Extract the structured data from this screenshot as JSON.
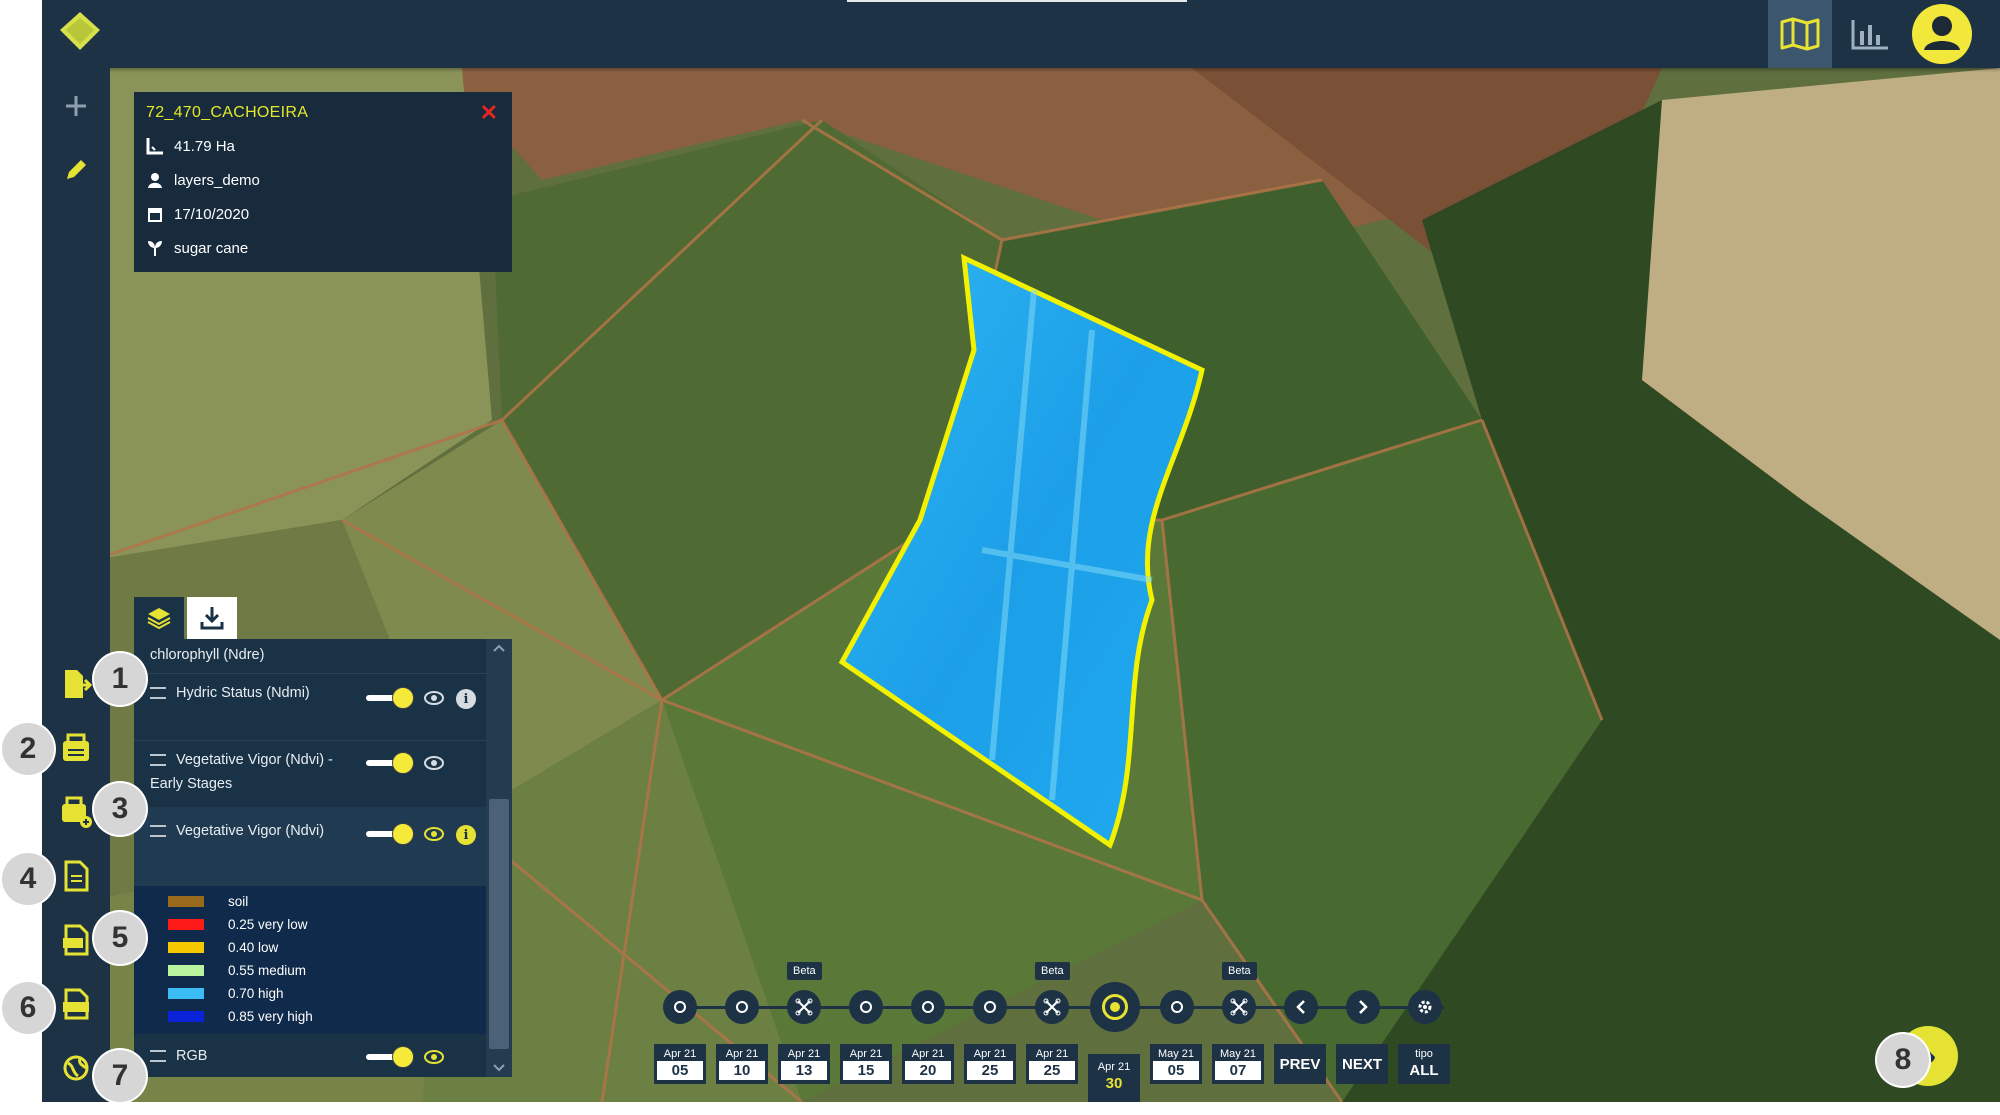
{
  "colors": {
    "accent_yellow": "#e6e234",
    "panel_dark": "#1d3245",
    "field_overlay": "#1aa8ee",
    "field_border": "#f2f200",
    "close_red": "#e2261f"
  },
  "topbar": {
    "icons": [
      "map-icon",
      "bar-chart-icon",
      "user-avatar-icon"
    ]
  },
  "sidebar": {
    "icons": [
      "plus-icon",
      "pencil-icon",
      "file-export-icon",
      "report-icon",
      "report-add-icon",
      "document-icon",
      "xls-icon",
      "json-icon",
      "globe-icon"
    ]
  },
  "badges": [
    "1",
    "2",
    "3",
    "4",
    "5",
    "6",
    "7",
    "8"
  ],
  "field_info": {
    "title": "72_470_CACHOEIRA",
    "close_label": "✕",
    "area": "41.79 Ha",
    "user": "layers_demo",
    "date": "17/10/2020",
    "crop": "sugar cane"
  },
  "layers": {
    "tabs": [
      "layers-icon",
      "download-icon"
    ],
    "partial_item": "chlorophyll (Ndre)",
    "items": [
      {
        "name": "Hydric Status (Ndmi)",
        "enabled": true,
        "has_info": true
      },
      {
        "name": "Vegetative Vigor (Ndvi) - Early Stages",
        "enabled": true,
        "has_info": false
      },
      {
        "name": "Vegetative Vigor (Ndvi)",
        "enabled": true,
        "has_info": true
      },
      {
        "name": "RGB",
        "enabled": true,
        "has_info": false
      }
    ],
    "legend": [
      {
        "label": "soil",
        "color": "#9a6a1c"
      },
      {
        "label": "0.25 very low",
        "color": "#ff1a1a"
      },
      {
        "label": "0.40 low",
        "color": "#f5c800"
      },
      {
        "label": "0.55 medium",
        "color": "#b8f39e"
      },
      {
        "label": "0.70 high",
        "color": "#3bbcf4"
      },
      {
        "label": "0.85 very high",
        "color": "#0a22d8"
      }
    ]
  },
  "timeline": {
    "beta_label": "Beta",
    "dates": [
      {
        "month": "Apr 21",
        "day": "05",
        "type": "satellite"
      },
      {
        "month": "Apr 21",
        "day": "10",
        "type": "satellite"
      },
      {
        "month": "Apr 21",
        "day": "13",
        "type": "drone",
        "beta": true
      },
      {
        "month": "Apr 21",
        "day": "15",
        "type": "satellite"
      },
      {
        "month": "Apr 21",
        "day": "20",
        "type": "satellite"
      },
      {
        "month": "Apr 21",
        "day": "25",
        "type": "satellite"
      },
      {
        "month": "Apr 21",
        "day": "25",
        "type": "drone",
        "beta": true
      },
      {
        "month": "Apr 21",
        "day": "30",
        "type": "satellite",
        "selected": true
      },
      {
        "month": "May 21",
        "day": "05",
        "type": "satellite"
      },
      {
        "month": "May 21",
        "day": "07",
        "type": "drone",
        "beta": true
      }
    ],
    "prev_label": "PREV",
    "next_label": "NEXT",
    "tipo_label": "tipo",
    "all_label": "ALL"
  }
}
